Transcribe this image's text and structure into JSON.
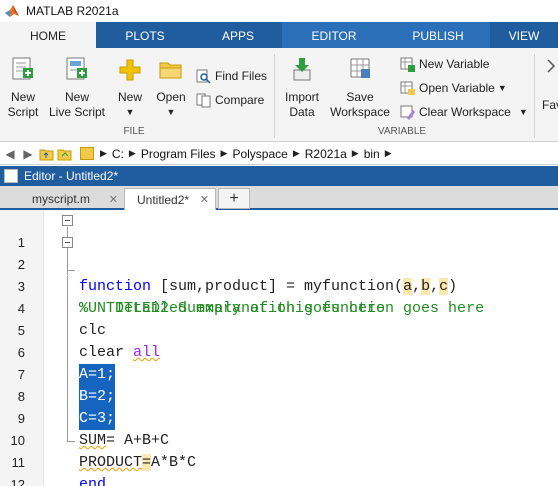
{
  "window": {
    "title": "MATLAB R2021a"
  },
  "tabs": [
    "HOME",
    "PLOTS",
    "APPS",
    "EDITOR",
    "PUBLISH",
    "VIEW"
  ],
  "ribbon": {
    "new_script": [
      "New",
      "Script"
    ],
    "new_live_script": [
      "New",
      "Live Script"
    ],
    "new": "New",
    "open": "Open",
    "find_files": "Find Files",
    "compare": "Compare",
    "file_group": "FILE",
    "import_data": [
      "Import",
      "Data"
    ],
    "save_workspace": [
      "Save",
      "Workspace"
    ],
    "new_variable": "New Variable",
    "open_variable": "Open Variable",
    "clear_workspace": "Clear Workspace",
    "variable_group": "VARIABLE",
    "fav_partial": "Fav"
  },
  "address": {
    "crumbs": [
      "C:",
      "Program Files",
      "Polyspace",
      "R2021a",
      "bin"
    ]
  },
  "editor": {
    "header": "Editor - Untitled2*",
    "doc_tabs": [
      "myscript.m",
      "Untitled2*"
    ],
    "new_tab": "+"
  },
  "code": {
    "line_numbers": [
      "1",
      "2",
      "3",
      "4",
      "5",
      "6",
      "7",
      "8",
      "9",
      "10",
      "11",
      "12"
    ],
    "l1": {
      "kw": "function",
      "rest1": " [sum,product] = myfunction(",
      "a": "a",
      "c1": ",",
      "b": "b",
      "c2": ",",
      "c": "c",
      "end": ")"
    },
    "l2": "%UNTITLED2 Summary of this function goes here",
    "l3": "%   Detailed explanation goes here",
    "l4": "clc",
    "l5": {
      "cmd": "clear ",
      "arg": "all"
    },
    "l6": "A=1;",
    "l7": "B=2;",
    "l8": "C=3;",
    "l9": {
      "a": "SUM",
      "b": "= A+B+C"
    },
    "l10": {
      "a": "PRODUCT",
      "b": "=",
      "c": "A*B*C"
    },
    "l11": "end",
    "l12": ""
  },
  "colors": {
    "accent": "#1f5d9e",
    "selection": "#1565c0",
    "keyword": "#0000ff",
    "comment": "#228b22",
    "string": "#a020f0"
  }
}
